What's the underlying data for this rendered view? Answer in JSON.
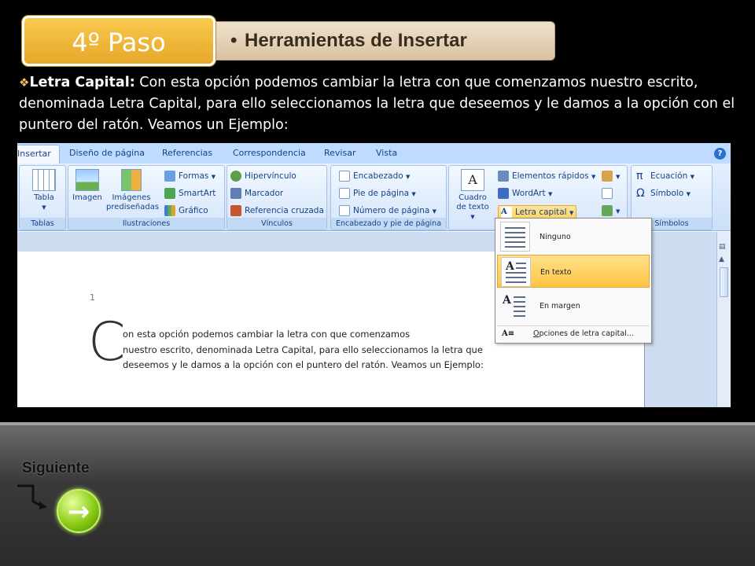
{
  "header": {
    "step_label": "4º Paso",
    "title_bullet": "•",
    "title": "Herramientas de Insertar"
  },
  "intro": {
    "bullet": "❖",
    "bold_label": "Letra Capital:",
    "text": " Con esta opción podemos cambiar la letra con que comenzamos nuestro escrito, denominada Letra Capital, para ello seleccionamos la letra que deseemos y le damos a la opción con el puntero del ratón. Veamos un Ejemplo:"
  },
  "ribbon": {
    "tabs": [
      "Insertar",
      "Diseño de página",
      "Referencias",
      "Correspondencia",
      "Revisar",
      "Vista"
    ],
    "help": "?",
    "groups": {
      "tablas": {
        "label": "Tablas",
        "tabla": "Tabla"
      },
      "ilustraciones": {
        "label": "Ilustraciones",
        "imagen": "Imagen",
        "imagenes_1": "Imágenes",
        "imagenes_2": "prediseñadas",
        "formas": "Formas",
        "smartart": "SmartArt",
        "grafico": "Gráfico"
      },
      "vinculos": {
        "label": "Vínculos",
        "hipervinculo": "Hipervínculo",
        "marcador": "Marcador",
        "referencia": "Referencia cruzada"
      },
      "encabezado": {
        "label": "Encabezado y pie de página",
        "encabezado": "Encabezado",
        "pie": "Pie de página",
        "numero": "Número de página"
      },
      "texto": {
        "cuadro_1": "Cuadro",
        "cuadro_2": "de texto",
        "elementos": "Elementos rápidos",
        "wordart": "WordArt",
        "letra_capital": "Letra capital"
      },
      "simbolos": {
        "label": "Símbolos",
        "ecuacion": "Ecuación",
        "simbolo": "Símbolo"
      }
    }
  },
  "document": {
    "line_number": "1",
    "dropcap": "C",
    "lines": [
      "on esta opción podemos cambiar la letra con que comenzamos",
      "nuestro escrito, denominada Letra Capital, para ello seleccionamos la letra que",
      "deseemos y le damos a la opción con el puntero del ratón. Veamos un Ejemplo:"
    ]
  },
  "dropdown": {
    "items": [
      {
        "label": "Ninguno"
      },
      {
        "label": "En texto"
      },
      {
        "label": "En margen"
      }
    ],
    "options_mnemonic": "O",
    "options_rest": "pciones de letra capital..."
  },
  "footer": {
    "next_label": "Siguiente",
    "next_arrow": "→"
  },
  "colors": {
    "badge": "#f0b83a",
    "title_bar": "#e5d2b5",
    "next_button": "#8ccc16",
    "ribbon": "#cbdff7"
  }
}
